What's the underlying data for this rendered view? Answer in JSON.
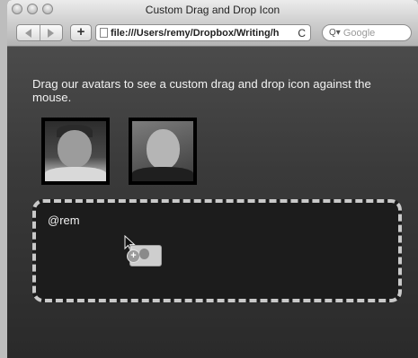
{
  "window": {
    "title": "Custom Drag and Drop Icon"
  },
  "toolbar": {
    "add_label": "+",
    "url": "file:///Users/remy/Dropbox/Writing/h",
    "reload_glyph": "C",
    "search_placeholder": "Google",
    "search_glyph": "Q▾"
  },
  "page": {
    "intro_text": "Drag our avatars to see a custom drag and drop icon against the mouse.",
    "drop_text": "@rem"
  },
  "icons": [
    "close-light",
    "minimize-light",
    "zoom-light",
    "back-arrow-icon",
    "forward-arrow-icon",
    "page-icon",
    "reload-icon",
    "search-icon",
    "cursor-icon",
    "plus-badge-icon"
  ],
  "colors": {
    "page_background": "#2e2e2e",
    "dropzone_border": "#c9c9c9",
    "dropzone_fill": "#1c1c1c",
    "text": "#f2f2f2"
  }
}
